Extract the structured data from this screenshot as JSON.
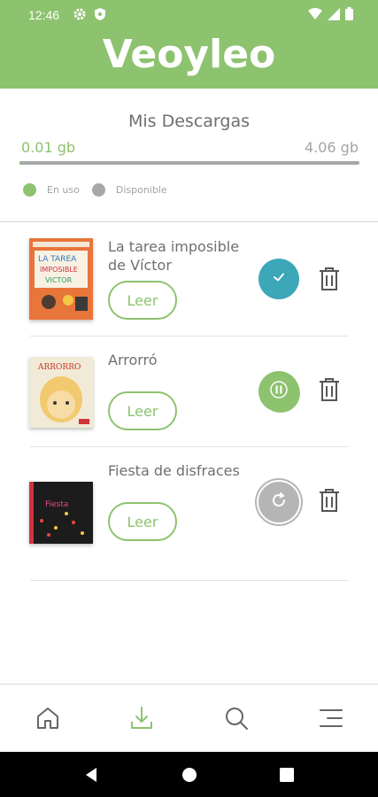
{
  "status_bar": {
    "time": "12:46"
  },
  "app": {
    "logo": "Veoyleo"
  },
  "storage": {
    "title": "Mis Descargas",
    "used": "0.01 gb",
    "total": "4.06 gb",
    "used_fraction": 0.0025,
    "legend_used": "En uso",
    "legend_available": "Disponible",
    "colors": {
      "used": "#8dc26f",
      "available": "#a8a8a8"
    }
  },
  "downloads": [
    {
      "title": "La tarea imposible de Víctor",
      "read_label": "Leer",
      "status": "downloaded",
      "status_color": "#3ba7b8"
    },
    {
      "title": "Arrorró",
      "read_label": "Leer",
      "status": "paused",
      "status_color": "#8dc26f"
    },
    {
      "title": "Fiesta de disfraces",
      "read_label": "Leer",
      "status": "pending",
      "status_color": "#b5b5b5"
    }
  ],
  "bottom_nav": {
    "items": [
      {
        "icon": "home-icon"
      },
      {
        "icon": "download-icon",
        "active": true
      },
      {
        "icon": "search-icon"
      },
      {
        "icon": "menu-icon"
      }
    ],
    "active_color": "#8dc26f",
    "inactive_color": "#666666"
  },
  "system_nav": {
    "icons": [
      "back-icon",
      "home-circle-icon",
      "recents-icon"
    ]
  }
}
